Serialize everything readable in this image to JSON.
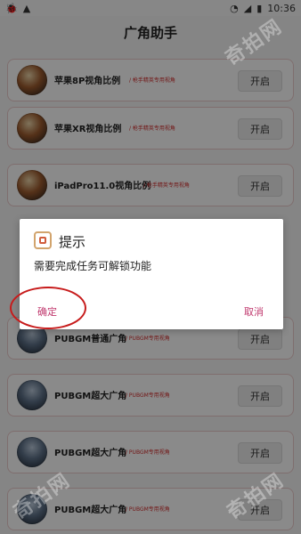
{
  "status_bar": {
    "time": "10:36"
  },
  "app": {
    "title": "广角助手"
  },
  "items": [
    {
      "title": "苹果8P视角比例",
      "tag": "/ 枪手精英专用视角",
      "button": "开启"
    },
    {
      "title": "苹果XR视角比例",
      "tag": "/ 枪手精英专用视角",
      "button": "开启"
    },
    {
      "title": "iPadPro11.0视角比例",
      "tag": "/ 枪手精英专用视角",
      "button": "开启"
    },
    {
      "title": "PUBGM普通广角",
      "tag": "/ PUBGM专用视角",
      "button": "开启"
    },
    {
      "title": "PUBGM超大广角",
      "tag": "/ PUBGM专用视角",
      "button": "开启"
    },
    {
      "title": "PUBGM超大广角",
      "tag": "/ PUBGM专用视角",
      "button": "开启"
    },
    {
      "title": "PUBGM超大广角",
      "tag": "/ PUBGM专用视角",
      "button": "开启"
    }
  ],
  "dialog": {
    "title": "提示",
    "message": "需要完成任务可解锁功能",
    "confirm": "确定",
    "cancel": "取消"
  },
  "watermark": "奇拍网",
  "colors": {
    "accent": "#c0396e",
    "tag": "#d02a2a",
    "highlight_ellipse": "#c71b1b"
  }
}
